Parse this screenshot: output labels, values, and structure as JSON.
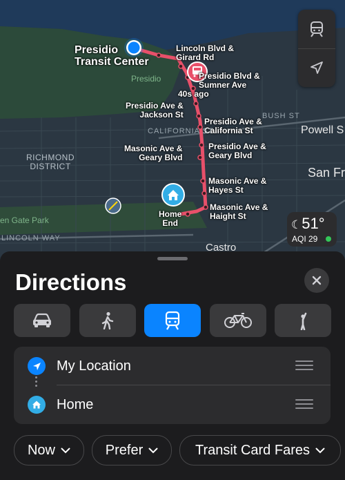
{
  "map": {
    "places": {
      "transit_center": "Presidio\nTransit Center",
      "home_end": "Home\nEnd"
    },
    "stops": [
      "Lincoln Blvd &\nGirard Rd",
      "Presidio Blvd &\nSumner Ave",
      "40s ago",
      "Presidio Ave &\nJackson St",
      "Presidio Ave &\nCalifornia St",
      "Masonic Ave &\nGeary Blvd",
      "Presidio Ave &\nGeary Blvd",
      "Masonic Ave &\nHayes St",
      "Masonic Ave &\nHaight St"
    ],
    "districts": {
      "richmond": "RICHMOND\nDISTRICT",
      "presidio": "Presidio",
      "golden_gate_park": "en Gate Park",
      "lincoln_way": "LINCOLN WAY",
      "california_st": "CALIFORNIA ST",
      "bush_st": "BUSH ST",
      "powell": "Powell S",
      "san_fran": "San Fr",
      "castro": "Castro"
    },
    "buttons": {
      "transit_icon": "tram-icon",
      "locate_icon": "location-arrow-icon"
    },
    "weather": {
      "temp": "51°",
      "aqi": "AQI 29",
      "aqi_color": "#34c759"
    },
    "route_color": "#e8506a",
    "user_color": "#0a84ff"
  },
  "sheet": {
    "title": "Directions",
    "modes": [
      {
        "name": "drive",
        "icon": "car-icon",
        "active": false
      },
      {
        "name": "walk",
        "icon": "walking-icon",
        "active": false
      },
      {
        "name": "transit",
        "icon": "tram-icon",
        "active": true
      },
      {
        "name": "cycle",
        "icon": "bicycle-icon",
        "active": false
      },
      {
        "name": "ride",
        "icon": "hail-icon",
        "active": false
      }
    ],
    "route": {
      "origin": "My Location",
      "destination": "Home"
    },
    "chips": {
      "time": "Now",
      "prefer": "Prefer",
      "fares": "Transit Card Fares"
    },
    "accent_color": "#0a84ff"
  }
}
